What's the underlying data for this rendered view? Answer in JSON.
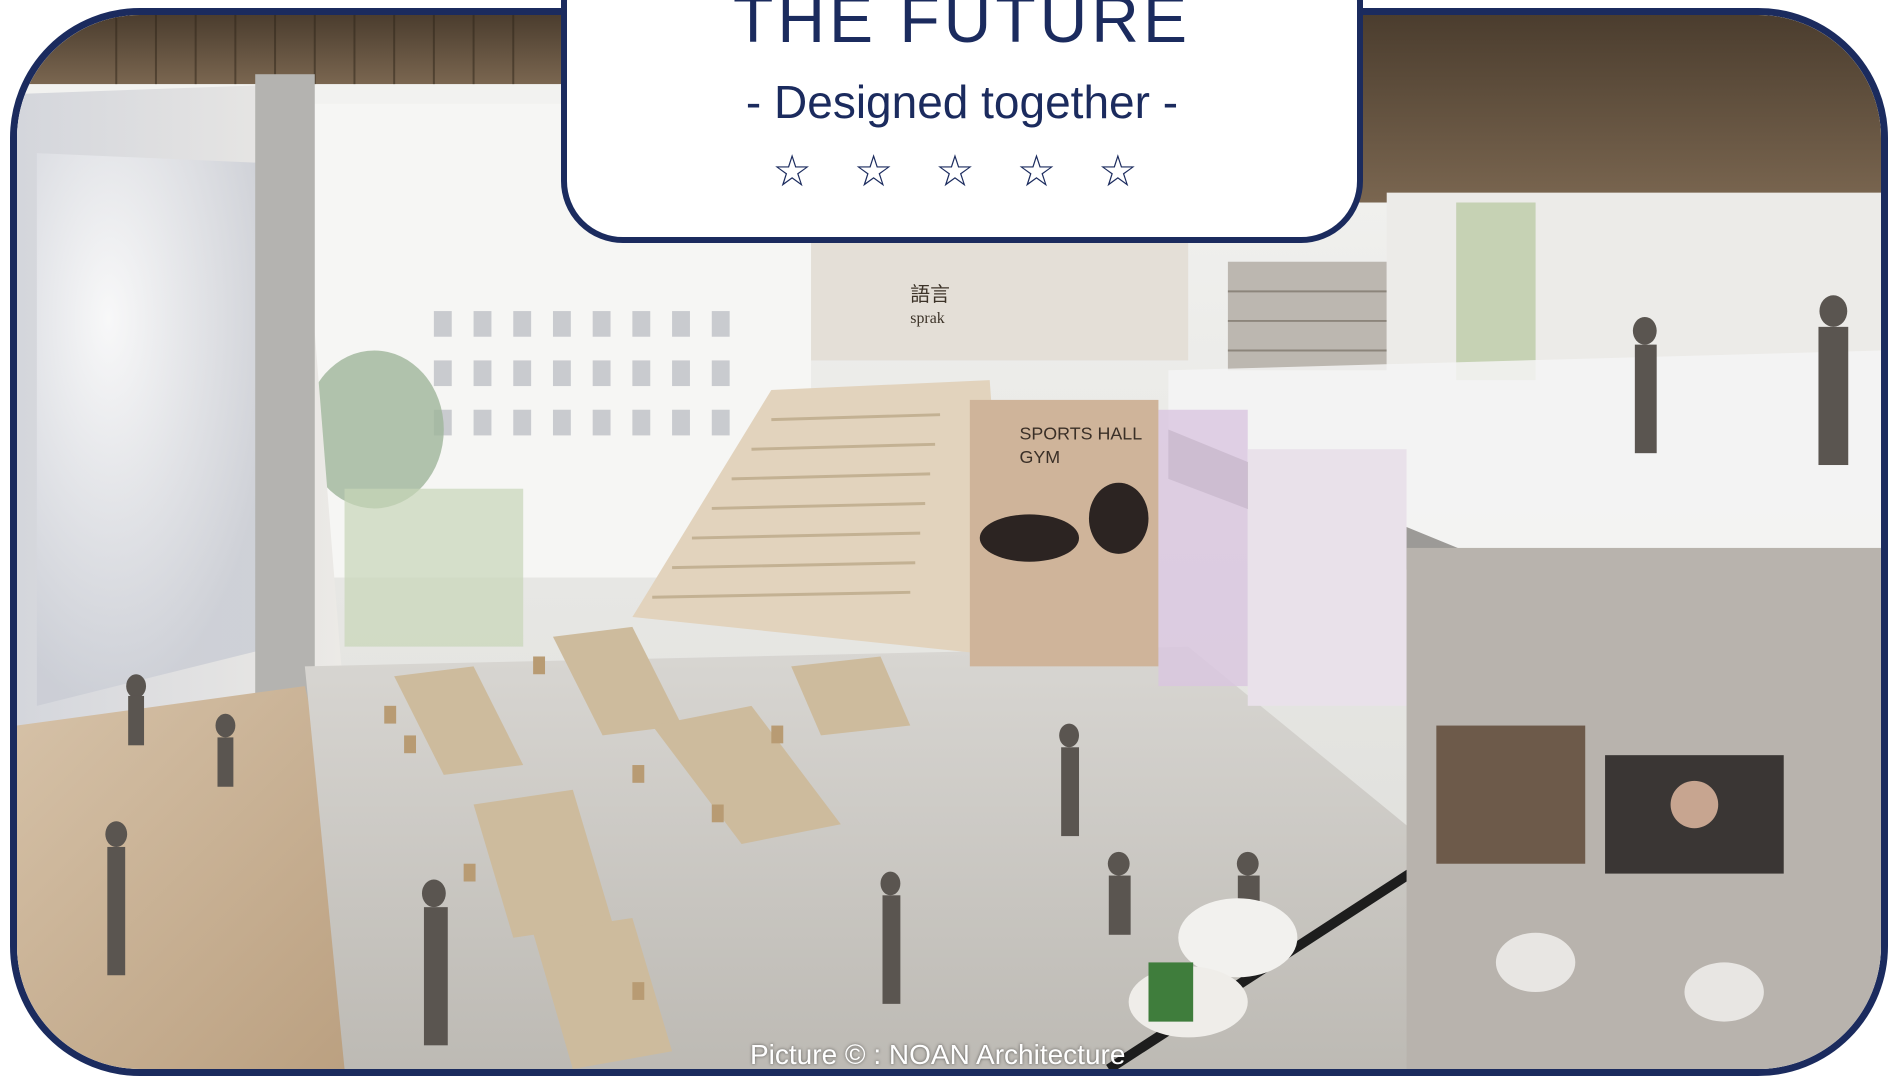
{
  "title_card": {
    "title": "THE FUTURE",
    "subtitle": "- Designed together -",
    "stars": "☆ ☆ ☆ ☆ ☆"
  },
  "illustration": {
    "sign_text_line1": "SPORTS HALL",
    "sign_text_line2": "GYM",
    "sign_language_1": "語言",
    "sign_language_2": "sprak"
  },
  "credit": "Picture © : NOAN Architecture",
  "colors": {
    "frame_border": "#1b2b5e",
    "title_text": "#1b2b5e",
    "card_background": "#ffffff"
  }
}
